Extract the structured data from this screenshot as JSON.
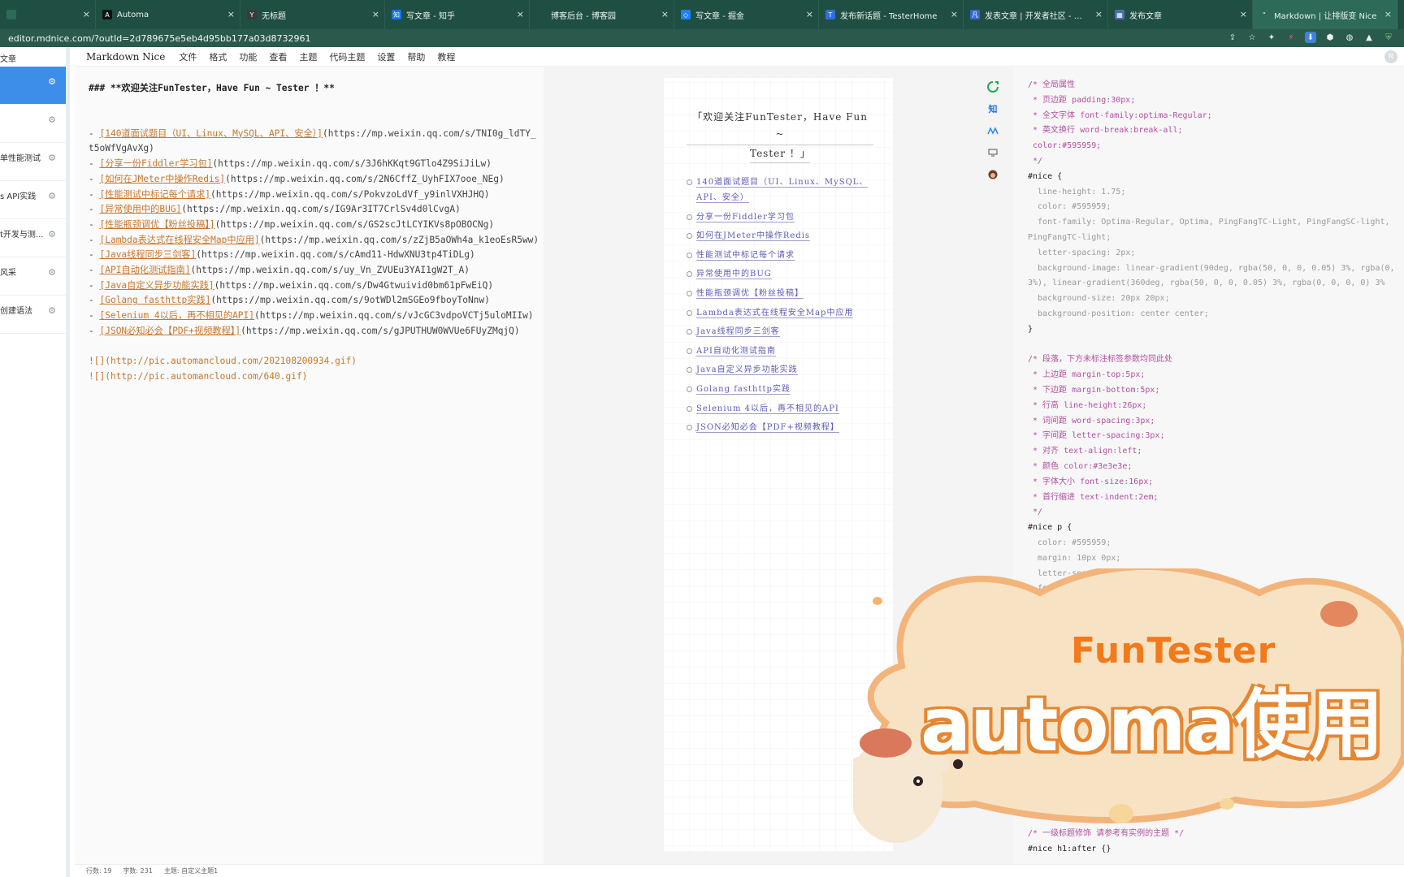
{
  "tabs": [
    {
      "title": "",
      "favicon_color": "#2d6a57",
      "favicon": ""
    },
    {
      "title": "Automa",
      "favicon_color": "#111111",
      "favicon": "A"
    },
    {
      "title": "无标题",
      "favicon_color": "#3a3a3a",
      "favicon": "Y"
    },
    {
      "title": "写文章 - 知乎",
      "favicon_color": "#1772f6",
      "favicon": "知"
    },
    {
      "title": "博客后台 - 博客园",
      "favicon_color": "#1f4f42",
      "favicon": ""
    },
    {
      "title": "写文章 - 掘金",
      "favicon_color": "#1e80ff",
      "favicon": "◇"
    },
    {
      "title": "发布新话题 - TesterHome",
      "favicon_color": "#2f6ee0",
      "favicon": "T"
    },
    {
      "title": "发表文章 | 开发者社区 - 专注...",
      "favicon_color": "#3767d6",
      "favicon": "凡"
    },
    {
      "title": "发布文章",
      "favicon_color": "#4a6fb5",
      "favicon": "▦"
    },
    {
      "title": "Markdown | 让排版变 Nice",
      "favicon_color": "#2d6a57",
      "favicon": "“"
    }
  ],
  "address": {
    "url": "editor.mdnice.com/?outId=2d789675e5eb4d95bb177a03d8732961"
  },
  "sidebar": {
    "header": "文章",
    "items": [
      {
        "label": "",
        "sub": ""
      },
      {
        "label": "",
        "sub": ""
      },
      {
        "label": "单性能测试",
        "sub": ""
      },
      {
        "label": "s API实践",
        "sub": ""
      },
      {
        "label": "t开发与测...",
        "sub": ""
      },
      {
        "label": "风采",
        "sub": ""
      },
      {
        "label": "创建语法",
        "sub": ""
      }
    ]
  },
  "menubar": {
    "brand": "Markdown Nice",
    "items": [
      "文件",
      "格式",
      "功能",
      "查看",
      "主题",
      "代码主题",
      "设置",
      "帮助",
      "教程"
    ],
    "avatar": "N"
  },
  "editor": {
    "heading": "### **欢迎关注FunTester，Have Fun ~ Tester ！**",
    "links": [
      {
        "text": "[140道面试题目（UI、Linux、MySQL、API、安全）]",
        "url": "(https://mp.weixin.qq.com/s/TNI0g_ldTY_t5oWfVgAvXg)"
      },
      {
        "text": "[分享一份Fiddler学习包]",
        "url": "(https://mp.weixin.qq.com/s/3J6hKKqt9GTlo4Z9SiJiLw)"
      },
      {
        "text": "[如何在JMeter中操作Redis]",
        "url": "(https://mp.weixin.qq.com/s/2N6CffZ_UyhFIX7ooe_NEg)"
      },
      {
        "text": "[性能测试中标记每个请求]",
        "url": "(https://mp.weixin.qq.com/s/PokvzoLdVf_y9inlVXHJHQ)"
      },
      {
        "text": "[异常使用中的BUG]",
        "url": "(https://mp.weixin.qq.com/s/IG9Ar3IT7CrlSv4d0lCvgA)"
      },
      {
        "text": "[性能瓶颈调优【粉丝投稿】]",
        "url": "(https://mp.weixin.qq.com/s/GS2scJtLCYIKVs8pOBOCNg)"
      },
      {
        "text": "[Lambda表达式在线程安全Map中应用]",
        "url": "(https://mp.weixin.qq.com/s/zZjB5aOWh4a_k1eoEsR5ww)"
      },
      {
        "text": "[Java线程同步三剑客]",
        "url": "(https://mp.weixin.qq.com/s/cAmd11-HdwXNU3tp4TiDLg)"
      },
      {
        "text": "[API自动化测试指南]",
        "url": "(https://mp.weixin.qq.com/s/uy_Vn_ZVUEu3YAI1gW2T_A)"
      },
      {
        "text": "[Java自定义异步功能实践]",
        "url": "(https://mp.weixin.qq.com/s/Dw4Gtwuivid0bm61pFwEiQ)"
      },
      {
        "text": "[Golang fasthttp实践]",
        "url": "(https://mp.weixin.qq.com/s/9otWDl2mSGEo9fboyToNnw)"
      },
      {
        "text": "[Selenium 4以后，再不相见的API]",
        "url": "(https://mp.weixin.qq.com/s/vJcGC3vdpoVCTj5uloMIIw)"
      },
      {
        "text": "[JSON必知必会【PDF+视频教程】]",
        "url": "(https://mp.weixin.qq.com/s/gJPUTHUW0WVUe6FUyZMqjQ)"
      }
    ],
    "images": [
      "![](http://pic.automancloud.com/202108200934.gif)",
      "![](http://pic.automancloud.com/640.gif)"
    ]
  },
  "preview": {
    "title_line1": "「欢迎关注FunTester，Have Fun ~",
    "title_line2": "Tester ！」",
    "items": [
      "140道面试题目（UI、Linux、MySQL、API、安全）",
      "分享一份Fiddler学习包",
      "如何在JMeter中操作Redis",
      "性能测试中标记每个请求",
      "异常使用中的BUG",
      "性能瓶颈调优【粉丝投稿】",
      "Lambda表达式在线程安全Map中应用",
      "Java线程同步三剑客",
      "API自动化测试指南",
      "Java自定义异步功能实践",
      "Golang fasthttp实践",
      "Selenium 4以后，再不相见的API",
      "JSON必知必会【PDF+视频教程】"
    ]
  },
  "tools": {
    "zhihu": "知"
  },
  "css_lines": [
    {
      "t": "/* 全局属性",
      "c": "cm"
    },
    {
      "t": " * 页边距 padding:30px;",
      "c": "cm"
    },
    {
      "t": " * 全文字体 font-family:optima-Regular;",
      "c": "cm"
    },
    {
      "t": " * 英文换行 word-break:break-all;",
      "c": "cm"
    },
    {
      "t": " color:#595959;",
      "c": "cm"
    },
    {
      "t": " */",
      "c": "cm"
    },
    {
      "t": "#nice {",
      "c": "sel"
    },
    {
      "t": "  line-height: 1.75;",
      "c": "prop"
    },
    {
      "t": "  color: #595959;",
      "c": "prop"
    },
    {
      "t": "  font-family: Optima-Regular, Optima, PingFangTC-Light, PingFangSC-light,",
      "c": "prop"
    },
    {
      "t": "PingFangTC-light;",
      "c": "prop"
    },
    {
      "t": "  letter-spacing: 2px;",
      "c": "prop"
    },
    {
      "t": "  background-image: linear-gradient(90deg, rgba(50, 0, 0, 0.05) 3%, rgba(0,",
      "c": "prop"
    },
    {
      "t": "3%), linear-gradient(360deg, rgba(50, 0, 0, 0.05) 3%, rgba(0, 0, 0, 0) 3%",
      "c": "prop"
    },
    {
      "t": "  background-size: 20px 20px;",
      "c": "prop"
    },
    {
      "t": "  background-position: center center;",
      "c": "prop"
    },
    {
      "t": "}",
      "c": "sel"
    },
    {
      "t": "",
      "c": "sel"
    },
    {
      "t": "/* 段落，下方未标注标签参数均同此处",
      "c": "cm"
    },
    {
      "t": " * 上边距 margin-top:5px;",
      "c": "cm"
    },
    {
      "t": " * 下边距 margin-bottom:5px;",
      "c": "cm"
    },
    {
      "t": " * 行高 line-height:26px;",
      "c": "cm"
    },
    {
      "t": " * 词间距 word-spacing:3px;",
      "c": "cm"
    },
    {
      "t": " * 字间距 letter-spacing:3px;",
      "c": "cm"
    },
    {
      "t": " * 对齐 text-align:left;",
      "c": "cm"
    },
    {
      "t": " * 颜色 color:#3e3e3e;",
      "c": "cm"
    },
    {
      "t": " * 字体大小 font-size:16px;",
      "c": "cm"
    },
    {
      "t": " * 首行缩进 text-indent:2em;",
      "c": "cm"
    },
    {
      "t": " */",
      "c": "cm"
    },
    {
      "t": "#nice p {",
      "c": "sel"
    },
    {
      "t": "  color: #595959;",
      "c": "prop"
    },
    {
      "t": "  margin: 10px 0px;",
      "c": "prop"
    },
    {
      "t": "  letter-spacing: 2px;",
      "c": "prop"
    },
    {
      "t": "  font-",
      "c": "prop"
    }
  ],
  "css_tail": [
    {
      "t": "/* 一级标题修饰 请参考有实例的主题 */",
      "c": "cm"
    },
    {
      "t": "#nice h1:after {}",
      "c": "sel"
    }
  ],
  "overlay": {
    "line1": "FunTester",
    "line2": "automa使用"
  },
  "status": {
    "lines": "行数: 19",
    "words": "字数: 231",
    "theme": "主题: 自定义主题1"
  }
}
